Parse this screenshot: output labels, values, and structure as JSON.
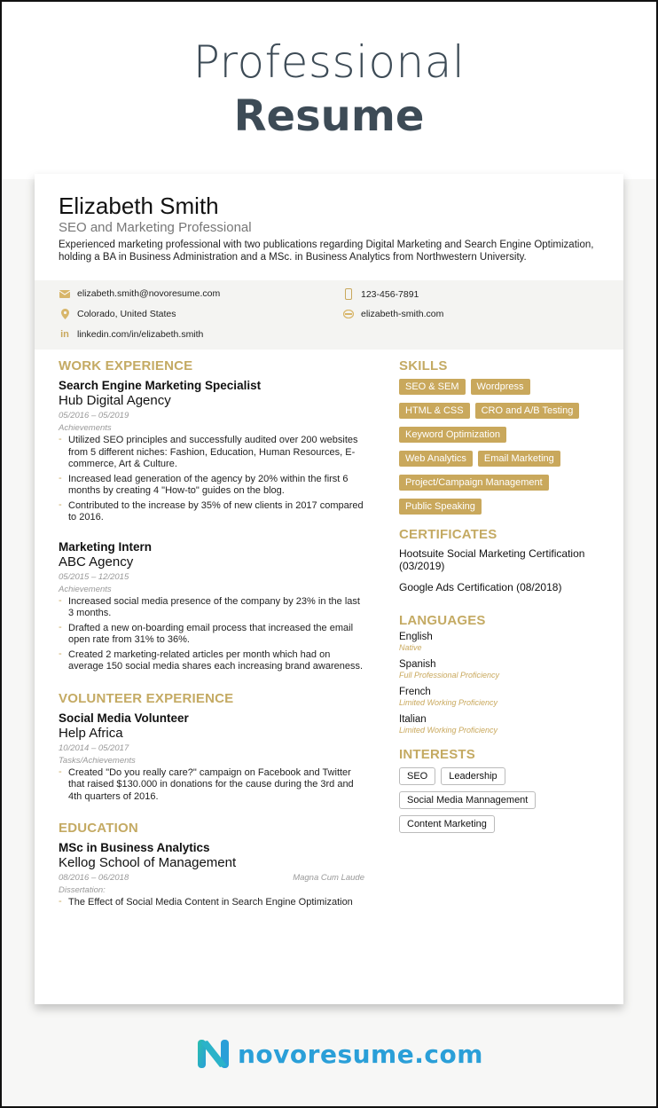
{
  "hero": {
    "line1": "Professional",
    "line2": "Resume"
  },
  "resume": {
    "name": "Elizabeth Smith",
    "role": "SEO and Marketing Professional",
    "summary": "Experienced marketing professional with two publications regarding Digital Marketing and Search Engine Optimization, holding a BA in Business Administration and a MSc. in Business Analytics from Northwestern University.",
    "contact": {
      "email": {
        "icon": "envelope-icon",
        "value": "elizabeth.smith@novoresume.com"
      },
      "phone": {
        "icon": "phone-icon",
        "value": "123-456-7891"
      },
      "location": {
        "icon": "location-pin-icon",
        "value": "Colorado, United States"
      },
      "website": {
        "icon": "globe-icon",
        "value": "elizabeth-smith.com"
      },
      "linkedin": {
        "icon": "linkedin-icon",
        "glyph": "in",
        "value": "linkedin.com/in/elizabeth.smith"
      }
    },
    "work": {
      "title": "WORK EXPERIENCE",
      "jobs": [
        {
          "title": "Search Engine Marketing Specialist",
          "company": "Hub Digital Agency",
          "dates": "05/2016 – 05/2019",
          "label": "Achievements",
          "bullets": [
            "Utilized SEO principles and successfully audited over 200 websites from 5 different niches: Fashion, Education, Human Resources, E-commerce, Art & Culture.",
            "Increased lead generation of the agency by 20% within the first 6 months by creating 4 \"How-to\" guides on the blog.",
            "Contributed to the increase by 35% of new clients in 2017 compared to 2016."
          ]
        },
        {
          "title": "Marketing Intern",
          "company": "ABC Agency",
          "dates": "05/2015 – 12/2015",
          "label": "Achievements",
          "bullets": [
            "Increased social media presence of the company by 23% in the last 3 months.",
            "Drafted a new on-boarding email process that increased the email open rate from 31% to 36%.",
            "Created 2 marketing-related articles per month which had on average 150 social media shares each increasing brand awareness."
          ]
        }
      ]
    },
    "volunteer": {
      "title": "VOLUNTEER EXPERIENCE",
      "role": "Social Media Volunteer",
      "org": "Help Africa",
      "dates": "10/2014 – 05/2017",
      "label": "Tasks/Achievements",
      "bullets": [
        "Created \"Do you really care?\" campaign on Facebook and Twitter that raised $130.000 in donations for the cause during the 3rd and 4th quarters of 2016."
      ]
    },
    "education": {
      "title": "EDUCATION",
      "degree": "MSc in Business Analytics",
      "school": "Kellog School of Management",
      "dates": "08/2016 – 06/2018",
      "honors": "Magna Cum Laude",
      "label": "Dissertation:",
      "bullets": [
        "The Effect of Social Media Content in Search Engine Optimization"
      ]
    },
    "skills": {
      "title": "SKILLS",
      "rows": [
        [
          "SEO & SEM",
          "Wordpress"
        ],
        [
          "HTML & CSS",
          "CRO and A/B Testing"
        ],
        [
          "Keyword Optimization"
        ],
        [
          "Web Analytics",
          "Email Marketing"
        ],
        [
          "Project/Campaign Management"
        ],
        [
          "Public Speaking"
        ]
      ]
    },
    "certificates": {
      "title": "CERTIFICATES",
      "items": [
        "Hootsuite Social Marketing Certification (03/2019)",
        "Google Ads Certification (08/2018)"
      ]
    },
    "languages": {
      "title": "LANGUAGES",
      "items": [
        {
          "name": "English",
          "level": "Native"
        },
        {
          "name": "Spanish",
          "level": "Full Professional Proficiency"
        },
        {
          "name": "French",
          "level": "Limited Working Proficiency"
        },
        {
          "name": "Italian",
          "level": "Limited Working Proficiency"
        }
      ]
    },
    "interests": {
      "title": "INTERESTS",
      "rows": [
        [
          "SEO",
          "Leadership"
        ],
        [
          "Social Media Mannagement"
        ],
        [
          "Content Marketing"
        ]
      ]
    }
  },
  "footer": {
    "logo_text": "novoresume.com"
  },
  "colors": {
    "accent": "#c9a85c",
    "heading": "#c4aa63",
    "hero": "#3d4b56",
    "logo": "#2a9fd8"
  }
}
